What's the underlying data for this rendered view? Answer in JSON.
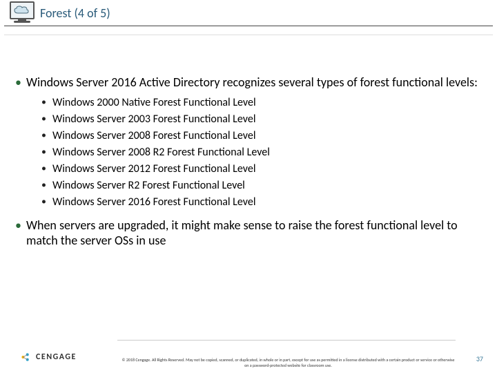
{
  "header": {
    "title": "Forest (4 of 5)",
    "icon": "cloud-monitor-icon"
  },
  "body": {
    "points": [
      {
        "text": "Windows Server 2016 Active Directory recognizes several types of forest functional levels:",
        "sub": [
          "Windows 2000 Native Forest Functional Level",
          "Windows Server 2003 Forest Functional Level",
          "Windows Server 2008 Forest Functional Level",
          "Windows Server 2008 R2 Forest Functional Level",
          "Windows Server 2012 Forest Functional Level",
          "Windows Server R2 Forest Functional Level",
          "Windows Server 2016 Forest Functional Level"
        ]
      },
      {
        "text": "When servers are upgraded, it might make sense to raise the forest functional level to match the server OSs in use",
        "sub": []
      }
    ]
  },
  "footer": {
    "brand": "CENGAGE",
    "copyright": "© 2018 Cengage. All Rights Reserved. May not be copied, scanned, or duplicated, in whole or in part, except for use as permitted in a license distributed with a certain product or service or otherwise on a password-protected website for classroom use.",
    "page": "37"
  }
}
